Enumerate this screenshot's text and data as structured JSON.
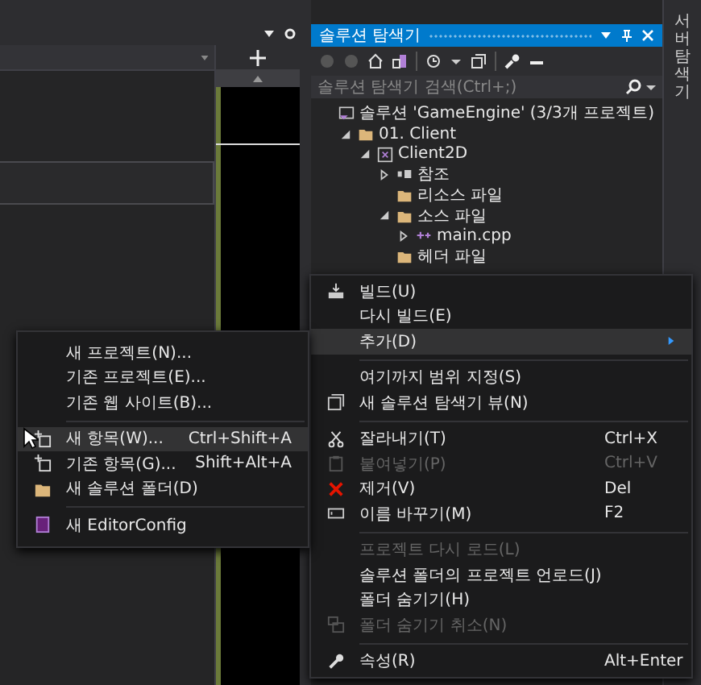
{
  "solution_explorer": {
    "title": "솔루션 탐색기",
    "search": {
      "placeholder": "솔루션 탐색기 검색(Ctrl+;)"
    },
    "tree": [
      {
        "label": "솔루션 'GameEngine' (3/3개 프로젝트)",
        "kind": "solution",
        "children": [
          {
            "label": "01. Client",
            "kind": "folder",
            "expanded": true,
            "children": [
              {
                "label": "Client2D",
                "kind": "project",
                "expanded": true,
                "children": [
                  {
                    "label": "참조",
                    "kind": "references",
                    "expanded": false
                  },
                  {
                    "label": "리소스 파일",
                    "kind": "filter"
                  },
                  {
                    "label": "소스 파일",
                    "kind": "filter",
                    "expanded": true,
                    "children": [
                      {
                        "label": "main.cpp",
                        "kind": "cpp",
                        "expanded": false
                      }
                    ]
                  },
                  {
                    "label": "헤더 파일",
                    "kind": "filter"
                  }
                ]
              }
            ]
          }
        ]
      }
    ]
  },
  "side_tab": {
    "label": "서버 탐색기"
  },
  "context_menu": {
    "items": [
      {
        "kind": "command",
        "label": "빌드(U)",
        "disabled": false
      },
      {
        "kind": "command",
        "label": "다시 빌드(E)",
        "disabled": false
      },
      {
        "kind": "submenu",
        "label": "추가(D)",
        "selected": true
      },
      {
        "kind": "separator"
      },
      {
        "kind": "command",
        "label": "여기까지 범위 지정(S)",
        "disabled": false
      },
      {
        "kind": "command",
        "label": "새 솔루션 탐색기 뷰(N)",
        "disabled": false
      },
      {
        "kind": "separator"
      },
      {
        "kind": "command",
        "label": "잘라내기(T)",
        "shortcut": "Ctrl+X",
        "disabled": false
      },
      {
        "kind": "command",
        "label": "붙여넣기(P)",
        "shortcut": "Ctrl+V",
        "disabled": true
      },
      {
        "kind": "command",
        "label": "제거(V)",
        "shortcut": "Del",
        "disabled": false
      },
      {
        "kind": "command",
        "label": "이름 바꾸기(M)",
        "shortcut": "F2",
        "disabled": false
      },
      {
        "kind": "separator"
      },
      {
        "kind": "command",
        "label": "프로젝트 다시 로드(L)",
        "disabled": true
      },
      {
        "kind": "command",
        "label": "솔루션 폴더의 프로젝트 언로드(J)",
        "disabled": false
      },
      {
        "kind": "command",
        "label": "폴더 숨기기(H)",
        "disabled": false
      },
      {
        "kind": "command",
        "label": "폴더 숨기기 취소(N)",
        "disabled": true
      },
      {
        "kind": "separator"
      },
      {
        "kind": "command",
        "label": "속성(R)",
        "shortcut": "Alt+Enter",
        "disabled": false
      }
    ]
  },
  "add_submenu": {
    "items": [
      {
        "kind": "command",
        "label": "새 프로젝트(N)...",
        "selected": false
      },
      {
        "kind": "command",
        "label": "기존 프로젝트(E)...",
        "selected": false
      },
      {
        "kind": "command",
        "label": "기존 웹 사이트(B)...",
        "selected": false
      },
      {
        "kind": "separator"
      },
      {
        "kind": "command",
        "label": "새 항목(W)...",
        "shortcut": "Ctrl+Shift+A",
        "selected": true
      },
      {
        "kind": "command",
        "label": "기존 항목(G)...",
        "shortcut": "Shift+Alt+A",
        "selected": false
      },
      {
        "kind": "command",
        "label": "새 솔루션 폴더(D)",
        "selected": false
      },
      {
        "kind": "separator"
      },
      {
        "kind": "command",
        "label": "새 EditorConfig",
        "selected": false
      }
    ]
  }
}
